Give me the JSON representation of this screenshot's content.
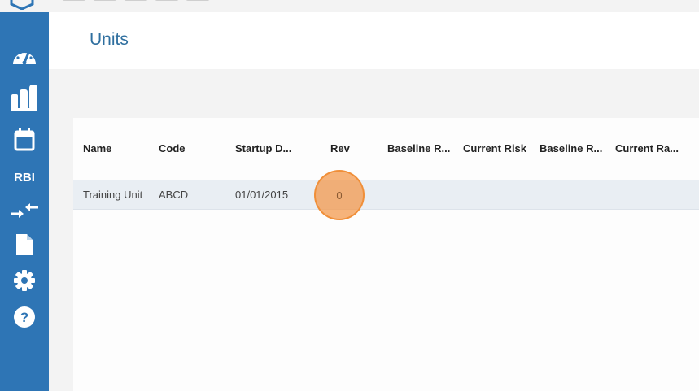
{
  "page": {
    "title": "Units"
  },
  "sidebar": {
    "items": [
      {
        "icon": "dashboard-icon"
      },
      {
        "icon": "plant-icon"
      },
      {
        "icon": "calendar-icon"
      },
      {
        "label": "RBI"
      },
      {
        "icon": "merge-arrows-icon"
      },
      {
        "icon": "document-icon"
      },
      {
        "icon": "gear-icon"
      },
      {
        "icon": "help-icon"
      }
    ]
  },
  "table": {
    "columns": [
      "Name",
      "Code",
      "Startup D...",
      "Rev",
      "Baseline R...",
      "Current Risk",
      "Baseline R...",
      "Current Ra..."
    ],
    "rows": [
      {
        "name": "Training Unit",
        "code": "ABCD",
        "startup_date": "01/01/2015",
        "rev": "0"
      }
    ]
  },
  "colors": {
    "sidebar": "#2e75b5",
    "title": "#2f6f9f",
    "row_highlight": "#e9eef3",
    "click_indicator": "#f39646"
  }
}
